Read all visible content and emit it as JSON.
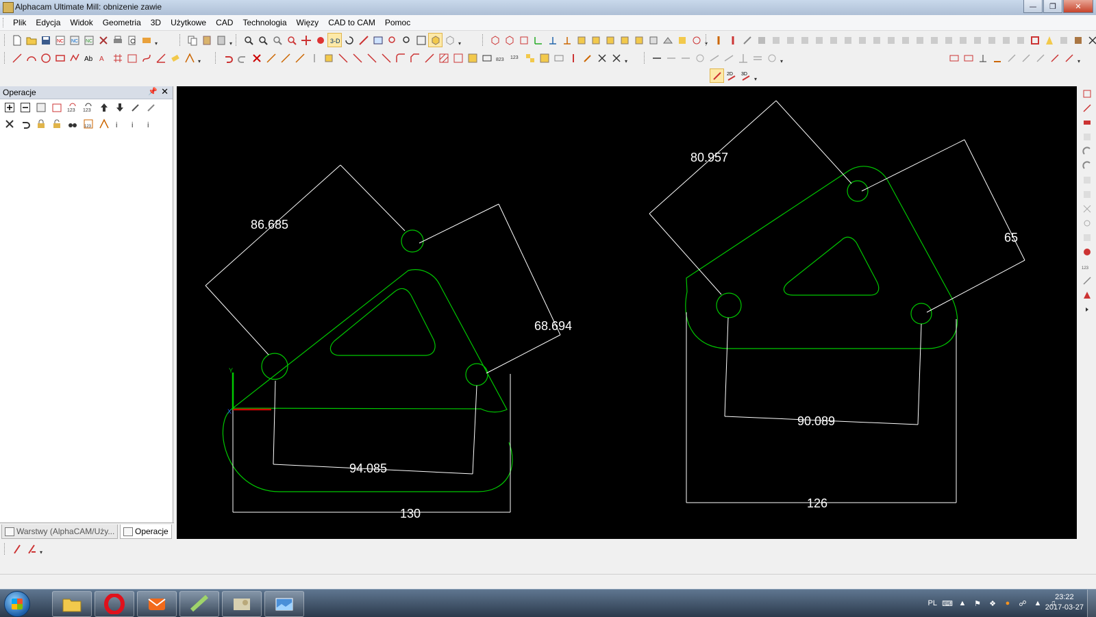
{
  "window": {
    "title": "Alphacam Ultimate Mill: obnizenie zawie"
  },
  "menu": [
    "Plik",
    "Edycja",
    "Widok",
    "Geometria",
    "3D",
    "Użytkowe",
    "CAD",
    "Technologia",
    "Więzy",
    "CAD to CAM",
    "Pomoc"
  ],
  "toolbar_top": {
    "mode_2d": "2D",
    "mode_3d": "3D"
  },
  "left_panel": {
    "title": "Operacje",
    "tabs": [
      {
        "label": "Warstwy (AlphaCAM/Uży..."
      },
      {
        "label": "Operacje"
      }
    ]
  },
  "drawing": {
    "part_left": {
      "dim_top": "86.685",
      "dim_right": "68.694",
      "dim_holes": "94.085",
      "dim_width": "130"
    },
    "part_right": {
      "dim_top": "80.957",
      "dim_right": "65",
      "dim_holes": "90.089",
      "dim_width": "126"
    },
    "axis": {
      "x": "X",
      "y": "Y"
    },
    "colors": {
      "background": "#000000",
      "geometry": "#00c800",
      "dimensions": "#ffffff",
      "x_axis": "#d00000",
      "y_axis": "#00c800"
    }
  },
  "taskbar": {
    "language": "PL",
    "time": "23:22",
    "date": "2017-03-27",
    "apps": [
      "file-explorer-icon",
      "opera-icon",
      "mail-icon",
      "alphacam-icon",
      "image-viewer-icon",
      "photo-gallery-icon"
    ]
  }
}
